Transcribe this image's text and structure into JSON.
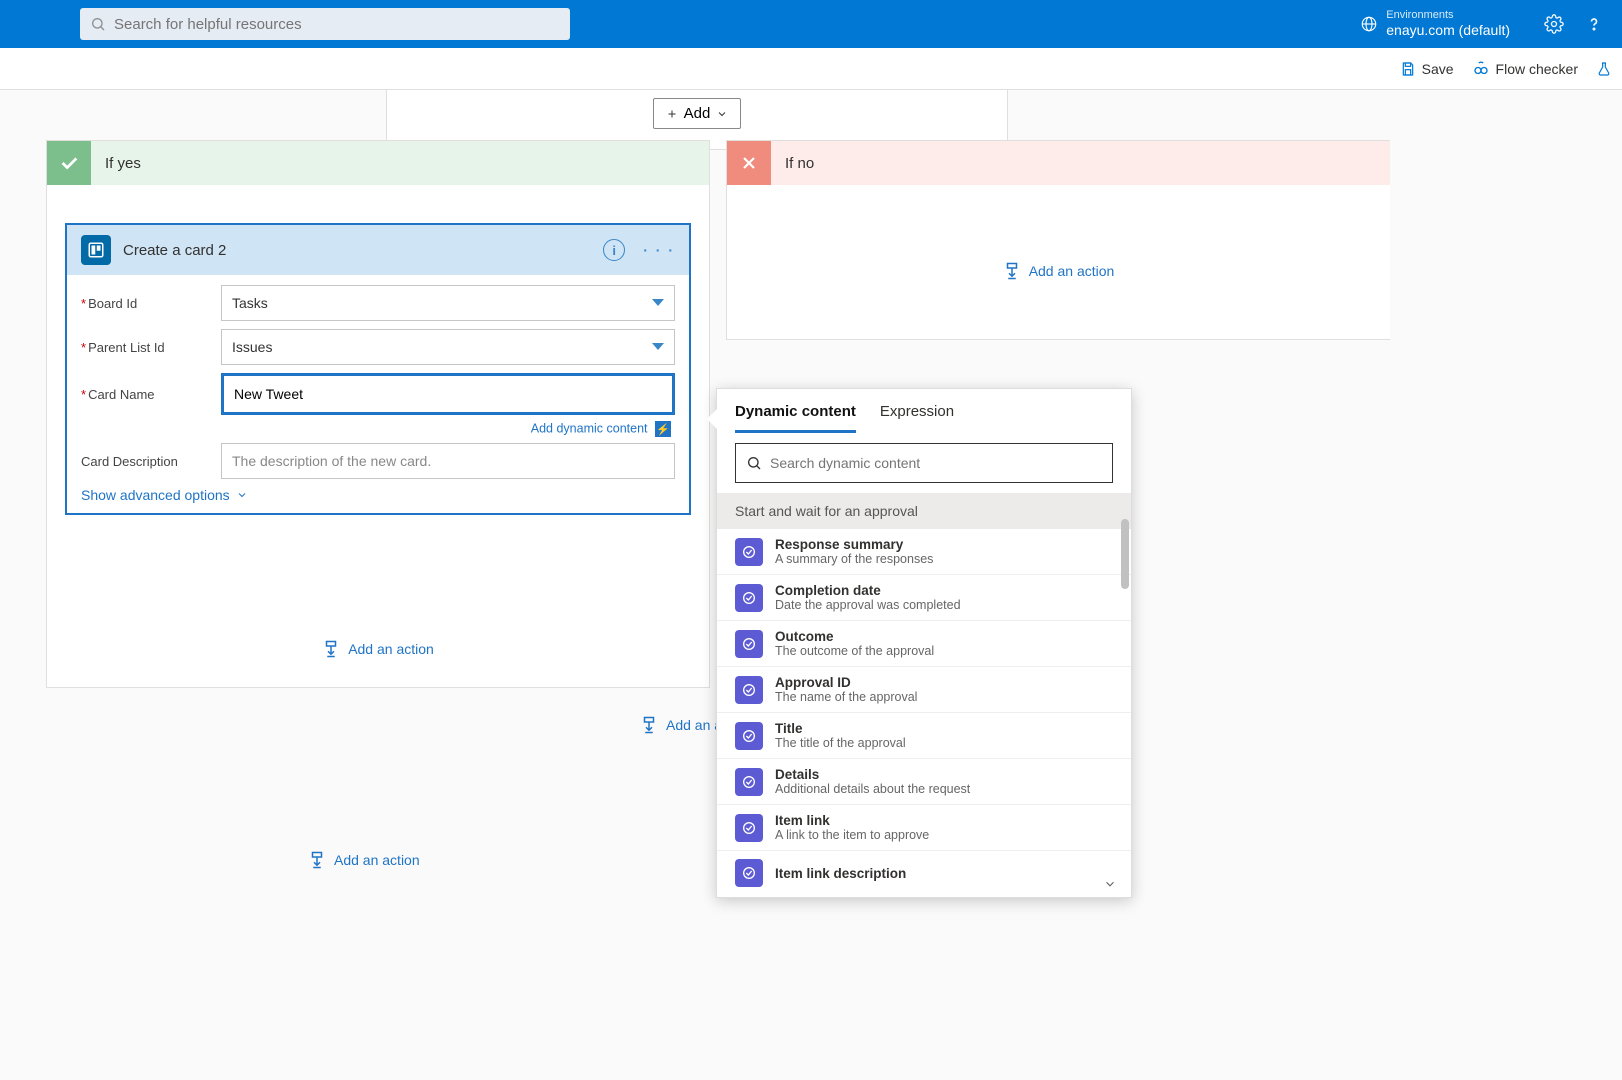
{
  "search": {
    "placeholder": "Search for helpful resources"
  },
  "env": {
    "label": "Environments",
    "name": "enayu.com (default)"
  },
  "cmdbar": {
    "save": "Save",
    "flow_checker": "Flow checker"
  },
  "condition": {
    "add": "Add"
  },
  "branches": {
    "yes": {
      "header": "If yes",
      "action": {
        "title": "Create a card 2",
        "fields": {
          "board_id_label": "Board Id",
          "board_id_value": "Tasks",
          "parent_list_label": "Parent List Id",
          "parent_list_value": "Issues",
          "card_name_label": "Card Name",
          "card_name_value": "New Tweet",
          "card_desc_label": "Card Description",
          "card_desc_placeholder": "The description of the new card."
        },
        "add_dynamic": "Add dynamic content",
        "show_advanced": "Show advanced options"
      },
      "add_action": "Add an action"
    },
    "no": {
      "header": "If no",
      "add_action": "Add an action"
    }
  },
  "outside": {
    "add1": "Add an a",
    "add2": "Add an action"
  },
  "dyn": {
    "tabs": {
      "dynamic": "Dynamic content",
      "expression": "Expression"
    },
    "search_placeholder": "Search dynamic content",
    "section": "Start and wait for an approval",
    "items": [
      {
        "title": "Response summary",
        "desc": "A summary of the responses"
      },
      {
        "title": "Completion date",
        "desc": "Date the approval was completed"
      },
      {
        "title": "Outcome",
        "desc": "The outcome of the approval"
      },
      {
        "title": "Approval ID",
        "desc": "The name of the approval"
      },
      {
        "title": "Title",
        "desc": "The title of the approval"
      },
      {
        "title": "Details",
        "desc": "Additional details about the request"
      },
      {
        "title": "Item link",
        "desc": "A link to the item to approve"
      },
      {
        "title": "Item link description",
        "desc": ""
      }
    ]
  }
}
